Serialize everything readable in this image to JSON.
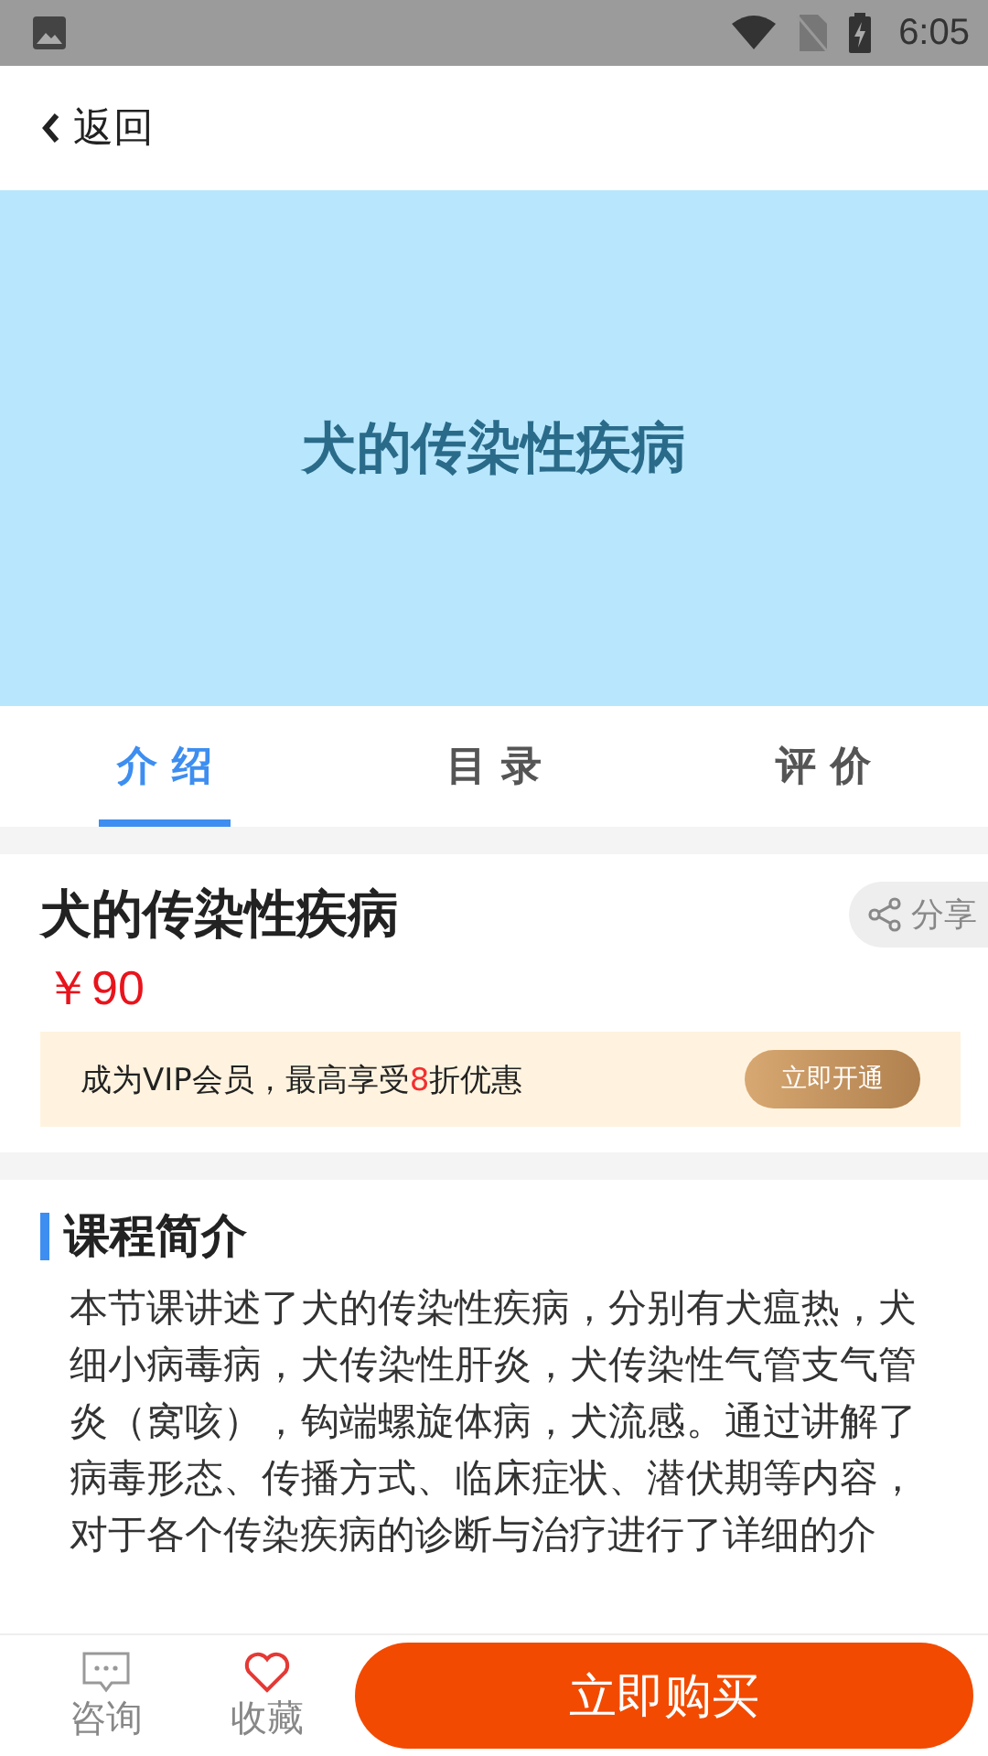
{
  "status_bar": {
    "time": "6:05"
  },
  "header": {
    "back_label": "返回"
  },
  "banner": {
    "title": "犬的传染性疾病"
  },
  "tabs": [
    {
      "label": "介 绍",
      "selected": true
    },
    {
      "label": "目 录",
      "selected": false
    },
    {
      "label": "评 价",
      "selected": false
    }
  ],
  "course": {
    "title": "犬的传染性疾病",
    "price": "￥90",
    "share_label": "分享"
  },
  "vip": {
    "text": "成为VIP会员，最高享受**8**折优惠",
    "button": "立即开通"
  },
  "intro": {
    "heading": "课程简介",
    "text": "本节课讲述了犬的传染性疾病，分别有犬瘟热，犬细小病毒病，犬传染性肝炎，犬传染性气管支气管炎（窝咳），钩端螺旋体病，犬流感。通过讲解了病毒形态、传播方式、临床症状、潜伏期等内容，对于各个传染疾病的诊断与治疗进行了详细的介"
  },
  "bottom_bar": {
    "consult_label": "咨询",
    "favorite_label": "收藏",
    "buy_button": "立即购买"
  }
}
